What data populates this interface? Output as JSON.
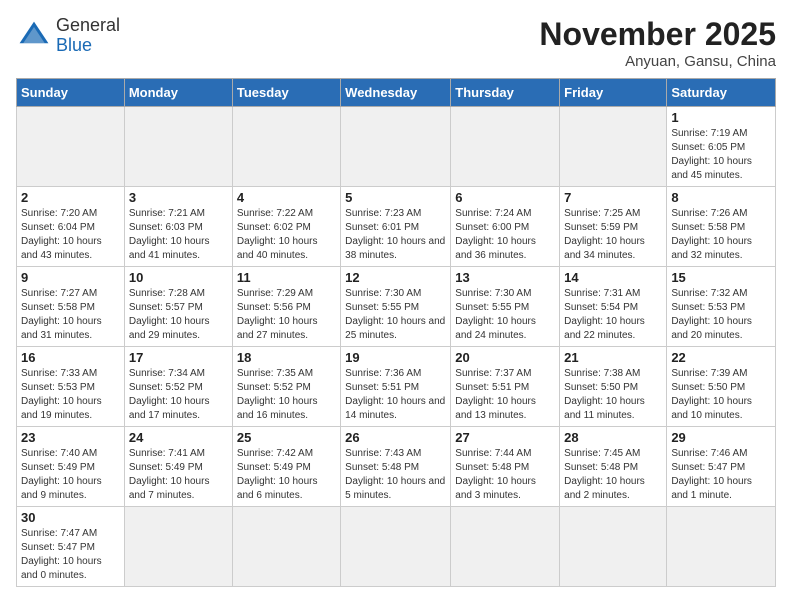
{
  "header": {
    "logo_general": "General",
    "logo_blue": "Blue",
    "month_title": "November 2025",
    "location": "Anyuan, Gansu, China"
  },
  "weekdays": [
    "Sunday",
    "Monday",
    "Tuesday",
    "Wednesday",
    "Thursday",
    "Friday",
    "Saturday"
  ],
  "weeks": [
    [
      {
        "day": "",
        "info": ""
      },
      {
        "day": "",
        "info": ""
      },
      {
        "day": "",
        "info": ""
      },
      {
        "day": "",
        "info": ""
      },
      {
        "day": "",
        "info": ""
      },
      {
        "day": "",
        "info": ""
      },
      {
        "day": "1",
        "info": "Sunrise: 7:19 AM\nSunset: 6:05 PM\nDaylight: 10 hours and 45 minutes."
      }
    ],
    [
      {
        "day": "2",
        "info": "Sunrise: 7:20 AM\nSunset: 6:04 PM\nDaylight: 10 hours and 43 minutes."
      },
      {
        "day": "3",
        "info": "Sunrise: 7:21 AM\nSunset: 6:03 PM\nDaylight: 10 hours and 41 minutes."
      },
      {
        "day": "4",
        "info": "Sunrise: 7:22 AM\nSunset: 6:02 PM\nDaylight: 10 hours and 40 minutes."
      },
      {
        "day": "5",
        "info": "Sunrise: 7:23 AM\nSunset: 6:01 PM\nDaylight: 10 hours and 38 minutes."
      },
      {
        "day": "6",
        "info": "Sunrise: 7:24 AM\nSunset: 6:00 PM\nDaylight: 10 hours and 36 minutes."
      },
      {
        "day": "7",
        "info": "Sunrise: 7:25 AM\nSunset: 5:59 PM\nDaylight: 10 hours and 34 minutes."
      },
      {
        "day": "8",
        "info": "Sunrise: 7:26 AM\nSunset: 5:58 PM\nDaylight: 10 hours and 32 minutes."
      }
    ],
    [
      {
        "day": "9",
        "info": "Sunrise: 7:27 AM\nSunset: 5:58 PM\nDaylight: 10 hours and 31 minutes."
      },
      {
        "day": "10",
        "info": "Sunrise: 7:28 AM\nSunset: 5:57 PM\nDaylight: 10 hours and 29 minutes."
      },
      {
        "day": "11",
        "info": "Sunrise: 7:29 AM\nSunset: 5:56 PM\nDaylight: 10 hours and 27 minutes."
      },
      {
        "day": "12",
        "info": "Sunrise: 7:30 AM\nSunset: 5:55 PM\nDaylight: 10 hours and 25 minutes."
      },
      {
        "day": "13",
        "info": "Sunrise: 7:30 AM\nSunset: 5:55 PM\nDaylight: 10 hours and 24 minutes."
      },
      {
        "day": "14",
        "info": "Sunrise: 7:31 AM\nSunset: 5:54 PM\nDaylight: 10 hours and 22 minutes."
      },
      {
        "day": "15",
        "info": "Sunrise: 7:32 AM\nSunset: 5:53 PM\nDaylight: 10 hours and 20 minutes."
      }
    ],
    [
      {
        "day": "16",
        "info": "Sunrise: 7:33 AM\nSunset: 5:53 PM\nDaylight: 10 hours and 19 minutes."
      },
      {
        "day": "17",
        "info": "Sunrise: 7:34 AM\nSunset: 5:52 PM\nDaylight: 10 hours and 17 minutes."
      },
      {
        "day": "18",
        "info": "Sunrise: 7:35 AM\nSunset: 5:52 PM\nDaylight: 10 hours and 16 minutes."
      },
      {
        "day": "19",
        "info": "Sunrise: 7:36 AM\nSunset: 5:51 PM\nDaylight: 10 hours and 14 minutes."
      },
      {
        "day": "20",
        "info": "Sunrise: 7:37 AM\nSunset: 5:51 PM\nDaylight: 10 hours and 13 minutes."
      },
      {
        "day": "21",
        "info": "Sunrise: 7:38 AM\nSunset: 5:50 PM\nDaylight: 10 hours and 11 minutes."
      },
      {
        "day": "22",
        "info": "Sunrise: 7:39 AM\nSunset: 5:50 PM\nDaylight: 10 hours and 10 minutes."
      }
    ],
    [
      {
        "day": "23",
        "info": "Sunrise: 7:40 AM\nSunset: 5:49 PM\nDaylight: 10 hours and 9 minutes."
      },
      {
        "day": "24",
        "info": "Sunrise: 7:41 AM\nSunset: 5:49 PM\nDaylight: 10 hours and 7 minutes."
      },
      {
        "day": "25",
        "info": "Sunrise: 7:42 AM\nSunset: 5:49 PM\nDaylight: 10 hours and 6 minutes."
      },
      {
        "day": "26",
        "info": "Sunrise: 7:43 AM\nSunset: 5:48 PM\nDaylight: 10 hours and 5 minutes."
      },
      {
        "day": "27",
        "info": "Sunrise: 7:44 AM\nSunset: 5:48 PM\nDaylight: 10 hours and 3 minutes."
      },
      {
        "day": "28",
        "info": "Sunrise: 7:45 AM\nSunset: 5:48 PM\nDaylight: 10 hours and 2 minutes."
      },
      {
        "day": "29",
        "info": "Sunrise: 7:46 AM\nSunset: 5:47 PM\nDaylight: 10 hours and 1 minute."
      }
    ],
    [
      {
        "day": "30",
        "info": "Sunrise: 7:47 AM\nSunset: 5:47 PM\nDaylight: 10 hours and 0 minutes."
      },
      {
        "day": "",
        "info": ""
      },
      {
        "day": "",
        "info": ""
      },
      {
        "day": "",
        "info": ""
      },
      {
        "day": "",
        "info": ""
      },
      {
        "day": "",
        "info": ""
      },
      {
        "day": "",
        "info": ""
      }
    ]
  ]
}
